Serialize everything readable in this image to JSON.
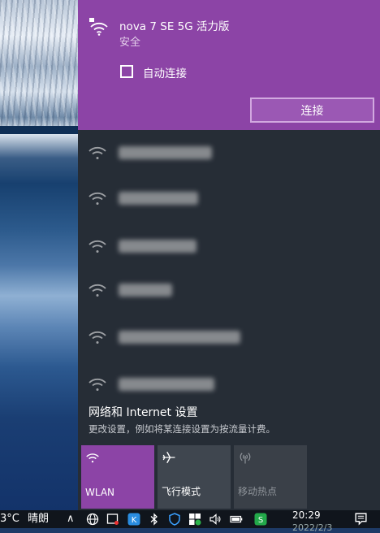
{
  "selected_network": {
    "ssid": "nova 7 SE 5G 活力版",
    "security": "安全",
    "auto_connect_label": "自动连接",
    "auto_connect_checked": false,
    "connect_button": "连接"
  },
  "other_networks": [
    {
      "name_hidden": true
    },
    {
      "name_hidden": true
    },
    {
      "name_hidden": true
    },
    {
      "name_hidden": true
    },
    {
      "name_hidden": true
    },
    {
      "name_hidden": true
    }
  ],
  "settings": {
    "title": "网络和 Internet 设置",
    "subtitle": "更改设置，例如将某连接设置为按流量计费。"
  },
  "quick_actions": [
    {
      "label": "WLAN",
      "icon": "wifi-icon",
      "active": true
    },
    {
      "label": "飞行模式",
      "icon": "airplane-icon",
      "active": false
    },
    {
      "label": "移动热点",
      "icon": "hotspot-icon",
      "active": false
    }
  ],
  "taskbar": {
    "weather": "3°C",
    "weather_text": "晴朗",
    "time": "20:29",
    "date": "2022/2/3"
  },
  "colors": {
    "accent": "#8c44a6",
    "flyout_bg": "#262d36",
    "taskbar_bg": "#10151c"
  }
}
